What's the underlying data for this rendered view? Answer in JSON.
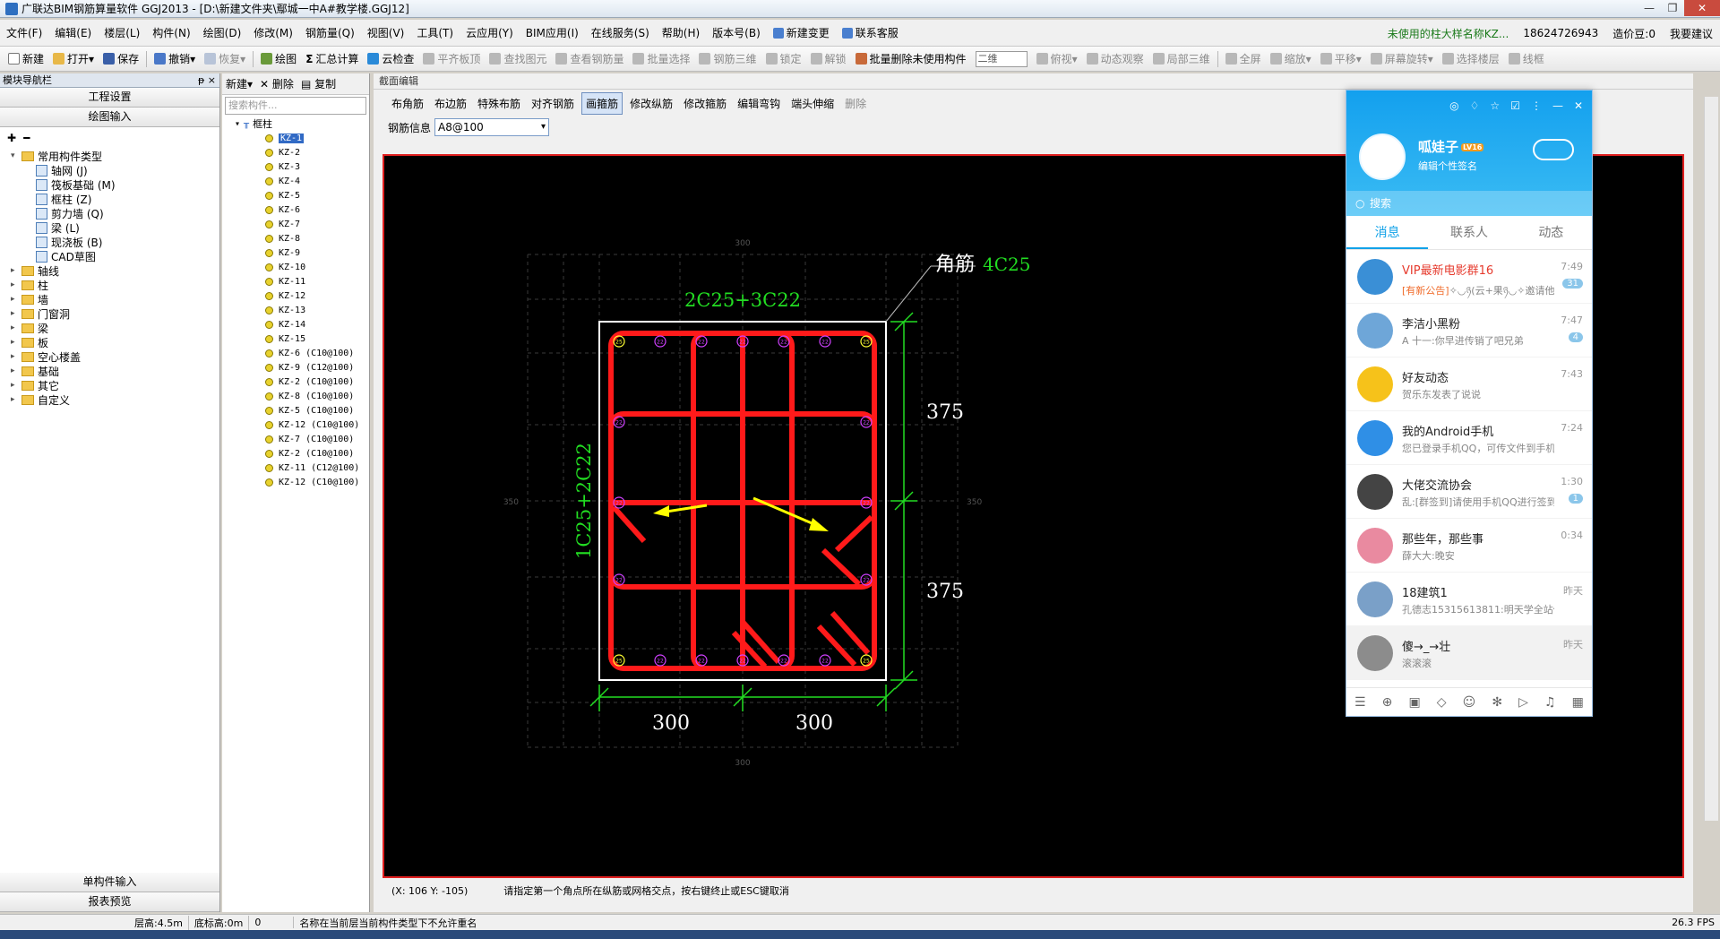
{
  "title": "广联达BIM钢筋算量软件 GGJ2013 - [D:\\新建文件夹\\鄢城一中A#教学楼.GGJ12]",
  "menu": {
    "items": [
      "文件(F)",
      "编辑(E)",
      "楼层(L)",
      "构件(N)",
      "绘图(D)",
      "修改(M)",
      "钢筋量(Q)",
      "视图(V)",
      "工具(T)",
      "云应用(Y)",
      "BIM应用(I)",
      "在线服务(S)",
      "帮助(H)",
      "版本号(B)",
      "新建变更",
      "联系客服"
    ],
    "warning": "未使用的柱大样名称KZ...",
    "phone": "18624726943",
    "beans": "造价豆:0",
    "advice": "我要建议"
  },
  "toolbar": {
    "items": [
      "新建",
      "打开",
      "保存",
      "撤销",
      "恢复",
      "绘图",
      "汇总计算",
      "云检查",
      "平齐板顶",
      "查找图元",
      "查看钢筋量",
      "批量选择",
      "钢筋三维",
      "锁定",
      "解锁",
      "批量删除未使用构件",
      "二维",
      "俯视",
      "动态观察",
      "局部三维",
      "全屏",
      "缩放",
      "平移",
      "屏幕旋转",
      "选择楼层",
      "线框"
    ]
  },
  "nav": {
    "header": "模块导航栏",
    "pin": "ᵽ ×",
    "project_settings": "工程设置",
    "drawing_input": "绘图输入",
    "tree": [
      {
        "label": "常用构件类型",
        "level": 0,
        "open": true
      },
      {
        "label": "轴网 (J)",
        "level": 1
      },
      {
        "label": "筏板基础 (M)",
        "level": 1
      },
      {
        "label": "框柱 (Z)",
        "level": 1
      },
      {
        "label": "剪力墙 (Q)",
        "level": 1
      },
      {
        "label": "梁 (L)",
        "level": 1
      },
      {
        "label": "现浇板 (B)",
        "level": 1
      },
      {
        "label": "CAD草图",
        "level": 1
      },
      {
        "label": "轴线",
        "level": 0
      },
      {
        "label": "柱",
        "level": 0
      },
      {
        "label": "墙",
        "level": 0
      },
      {
        "label": "门窗洞",
        "level": 0
      },
      {
        "label": "梁",
        "level": 0
      },
      {
        "label": "板",
        "level": 0
      },
      {
        "label": "空心楼盖",
        "level": 0
      },
      {
        "label": "基础",
        "level": 0
      },
      {
        "label": "其它",
        "level": 0
      },
      {
        "label": "自定义",
        "level": 0
      }
    ],
    "single_input": "单构件输入",
    "report_preview": "报表预览"
  },
  "components": {
    "new": "新建",
    "delete": "删除",
    "copy": "复制",
    "search_placeholder": "搜索构件...",
    "root": "框柱",
    "items": [
      "KZ-1",
      "KZ-2",
      "KZ-3",
      "KZ-4",
      "KZ-5",
      "KZ-6",
      "KZ-7",
      "KZ-8",
      "KZ-9",
      "KZ-10",
      "KZ-11",
      "KZ-12",
      "KZ-13",
      "KZ-14",
      "KZ-15",
      "KZ-6 (C10@100)",
      "KZ-9 (C12@100)",
      "KZ-2 (C10@100)",
      "KZ-8 (C10@100)",
      "KZ-5 (C10@100)",
      "KZ-12 (C10@100)",
      "KZ-7 (C10@100)",
      "KZ-2 (C10@100)",
      "KZ-11 (C12@100)",
      "KZ-12 (C10@100)"
    ],
    "selected_index": 0
  },
  "editor": {
    "header": "截面编辑",
    "tabs": [
      "布角筋",
      "布边筋",
      "特殊布筋",
      "对齐钢筋",
      "画箍筋",
      "修改纵筋",
      "修改箍筋",
      "编辑弯钩",
      "端头伸缩",
      "删除"
    ],
    "active_tab": 4,
    "rebar_info_label": "钢筋信息",
    "rebar_info_value": "A8@100",
    "section": {
      "corner_label": "角筋",
      "corner_value": "4C25",
      "top_label": "2C25+3C22",
      "side_label": "1C25+2C22",
      "dim_h1": "375",
      "dim_h2": "375",
      "dim_w1": "300",
      "dim_w2": "300",
      "grid_top": "300",
      "grid_bottom": "300",
      "grid_left": "350",
      "grid_right": "350",
      "corner_bar": "25",
      "edge_bar": "22"
    },
    "coords": "(X: 106 Y: -105)",
    "prompt": "请指定第一个角点所在纵筋或网格交点，按右键终止或ESC键取消"
  },
  "status": {
    "floor_height": "层高:4.5m",
    "bottom_height": "底标高:0m",
    "zero": "0",
    "message": "名称在当前层当前构件类型下不允许重名",
    "fps": "26.3 FPS"
  },
  "qq": {
    "name": "呱娃子",
    "level": "LV16",
    "signature": "编辑个性签名",
    "search": "搜索",
    "tabs": [
      "消息",
      "联系人",
      "动态"
    ],
    "active_tab": 0,
    "messages": [
      {
        "name": "VIP最新电影群16",
        "vip": true,
        "announce": "[有新公告]",
        "msg": "✧◡ཉ(云+果ཉ◡✧邀请他",
        "time": "7:49",
        "badge": "31",
        "color": "#3a8fd6"
      },
      {
        "name": "李洁小黑粉",
        "vip": false,
        "announce": "",
        "msg": "A 十一:你早进传销了吧兄弟",
        "time": "7:47",
        "badge": "4",
        "color": "#6ea6d8"
      },
      {
        "name": "好友动态",
        "vip": false,
        "announce": "",
        "msg": "贺乐东发表了说说",
        "time": "7:43",
        "badge": "",
        "color": "#f6c21a"
      },
      {
        "name": "我的Android手机",
        "vip": false,
        "announce": "",
        "msg": "您已登录手机QQ，可传文件到手机",
        "time": "7:24",
        "badge": "",
        "color": "#2f8fe6"
      },
      {
        "name": "大佬交流协会",
        "vip": false,
        "announce": "",
        "msg": "乱:[群签到]请使用手机QQ进行签到",
        "time": "1:30",
        "badge": "1",
        "color": "#444444"
      },
      {
        "name": "那些年，那些事",
        "vip": false,
        "announce": "",
        "msg": "薛大大:晚安",
        "time": "0:34",
        "badge": "",
        "color": "#e98aa0"
      },
      {
        "name": "18建筑1",
        "vip": false,
        "announce": "",
        "msg": "孔德志15315613811:明天学全站仪",
        "time": "昨天",
        "badge": "",
        "color": "#7aa0c8"
      },
      {
        "name": "傻→_→壮",
        "vip": false,
        "announce": "",
        "msg": "滚滚滚",
        "time": "昨天",
        "badge": "",
        "color": "#8c8c8c"
      }
    ]
  }
}
